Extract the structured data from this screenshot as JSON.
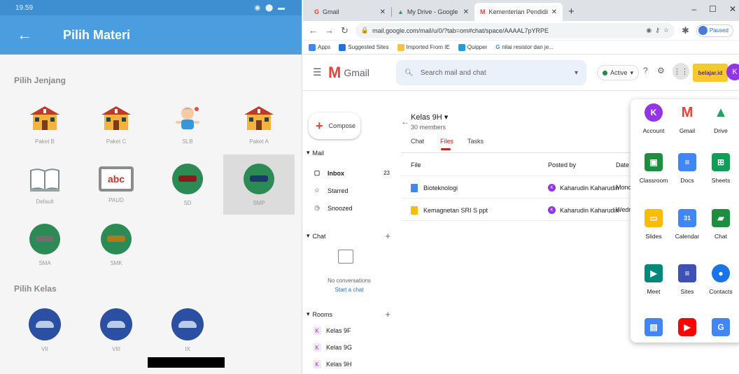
{
  "phone": {
    "status_time": "19.59",
    "status_right": "◉ ⬤ ▬",
    "appbar": {
      "back_icon": "arrow-back-icon",
      "title": "Pilih Materi"
    },
    "section_jenjang": {
      "title": "Pilih Jenjang",
      "items": [
        {
          "label": "Paket B",
          "icon": "school-building-icon"
        },
        {
          "label": "Paket C",
          "icon": "school-building-icon"
        },
        {
          "label": "SLB",
          "icon": "child-icon"
        },
        {
          "label": "Paket A",
          "icon": "school-building-icon"
        },
        {
          "label": "Default",
          "icon": "book-icon"
        },
        {
          "label": "PAUD",
          "icon": "abc-board-icon"
        },
        {
          "label": "SD",
          "icon": "student-icon"
        },
        {
          "label": "SMP",
          "icon": "student-icon",
          "selected": true
        },
        {
          "label": "SMA",
          "icon": "student-icon"
        },
        {
          "label": "SMK",
          "icon": "student-icon"
        }
      ]
    },
    "section_kelas": {
      "title": "Pilih Kelas",
      "items": [
        {
          "label": "VII"
        },
        {
          "label": "VIII"
        },
        {
          "label": "IX"
        }
      ]
    }
  },
  "browser": {
    "tabs": [
      {
        "label": "Gmail",
        "icon": "gmail-icon"
      },
      {
        "label": "My Drive - Google Drive",
        "icon": "drive-icon"
      },
      {
        "label": "Kementerian Pendidikan dan Kel",
        "icon": "gmail-icon",
        "active": true
      }
    ],
    "new_tab": "+",
    "window_controls": [
      "–",
      "☐",
      "✕"
    ],
    "url": "mail.google.com/mail/u/0/?tab=om#chat/space/AAAAL7pYRPE",
    "profile_status": "Paused",
    "bookmarks": [
      {
        "label": "Apps",
        "color": "#4285f4"
      },
      {
        "label": "Suggested Sites",
        "color": "#1a73e8"
      },
      {
        "label": "Imported From IE",
        "color": "#f5c242"
      },
      {
        "label": "Quipper",
        "color": "#1a9fe0"
      },
      {
        "label": "nilai resistor dan je...",
        "color": "#4285f4"
      }
    ]
  },
  "gmail": {
    "logo_text": "Gmail",
    "search_placeholder": "Search mail and chat",
    "status_label": "Active",
    "brand_badge": "belajar.id",
    "avatar_letter": "K",
    "compose_label": "Compose",
    "mail_section": "Mail",
    "mail_items": [
      {
        "label": "Inbox",
        "icon": "inbox-icon",
        "count": "23"
      },
      {
        "label": "Starred",
        "icon": "star-icon"
      },
      {
        "label": "Snoozed",
        "icon": "clock-icon"
      }
    ],
    "chat_section": "Chat",
    "no_conversations": "No conversations",
    "start_chat": "Start a chat",
    "rooms_section": "Rooms",
    "rooms": [
      "Kelas 9F",
      "Kelas 9G",
      "Kelas 9H"
    ],
    "space": {
      "name": "Kelas 9H",
      "members": "30 members",
      "tabs": [
        "Chat",
        "Files",
        "Tasks"
      ],
      "columns": [
        "File",
        "Posted by",
        "Date p"
      ],
      "files": [
        {
          "name": "Bioteknologi",
          "posted_by": "Kaharudin Kaharudin",
          "date": "Monda",
          "icon_color": "#4285f4"
        },
        {
          "name": "Kemagnetan SRI S ppt",
          "posted_by": "Kaharudin Kaharudin",
          "date": "Wedne",
          "icon_color": "#fbbc04"
        }
      ]
    },
    "apps": [
      {
        "label": "Account",
        "icon": "account-icon",
        "color": "#9334e6",
        "glyph": "K"
      },
      {
        "label": "Gmail",
        "icon": "gmail-icon",
        "color": "#ea4335",
        "glyph": "M"
      },
      {
        "label": "Drive",
        "icon": "drive-icon",
        "color": "#1fa463",
        "glyph": "▲"
      },
      {
        "label": "Classroom",
        "icon": "classroom-icon",
        "color": "#1e8e3e",
        "glyph": "▣"
      },
      {
        "label": "Docs",
        "icon": "docs-icon",
        "color": "#4285f4",
        "glyph": "≡"
      },
      {
        "label": "Sheets",
        "icon": "sheets-icon",
        "color": "#0f9d58",
        "glyph": "⊞"
      },
      {
        "label": "Slides",
        "icon": "slides-icon",
        "color": "#fbbc04",
        "glyph": "▭"
      },
      {
        "label": "Calendar",
        "icon": "calendar-icon",
        "color": "#4285f4",
        "glyph": "31"
      },
      {
        "label": "Chat",
        "icon": "chat-icon",
        "color": "#1e8e3e",
        "glyph": "▰"
      },
      {
        "label": "Meet",
        "icon": "meet-icon",
        "color": "#00897b",
        "glyph": "▶"
      },
      {
        "label": "Sites",
        "icon": "sites-icon",
        "color": "#3f51b5",
        "glyph": "≡"
      },
      {
        "label": "Contacts",
        "icon": "contacts-icon",
        "color": "#1a73e8",
        "glyph": "●"
      },
      {
        "label": "",
        "icon": "directory-icon",
        "color": "#4285f4",
        "glyph": "▤"
      },
      {
        "label": "",
        "icon": "youtube-icon",
        "color": "#ff0000",
        "glyph": "▶"
      },
      {
        "label": "",
        "icon": "forms-icon",
        "color": "#4285f4",
        "glyph": "G"
      }
    ]
  }
}
